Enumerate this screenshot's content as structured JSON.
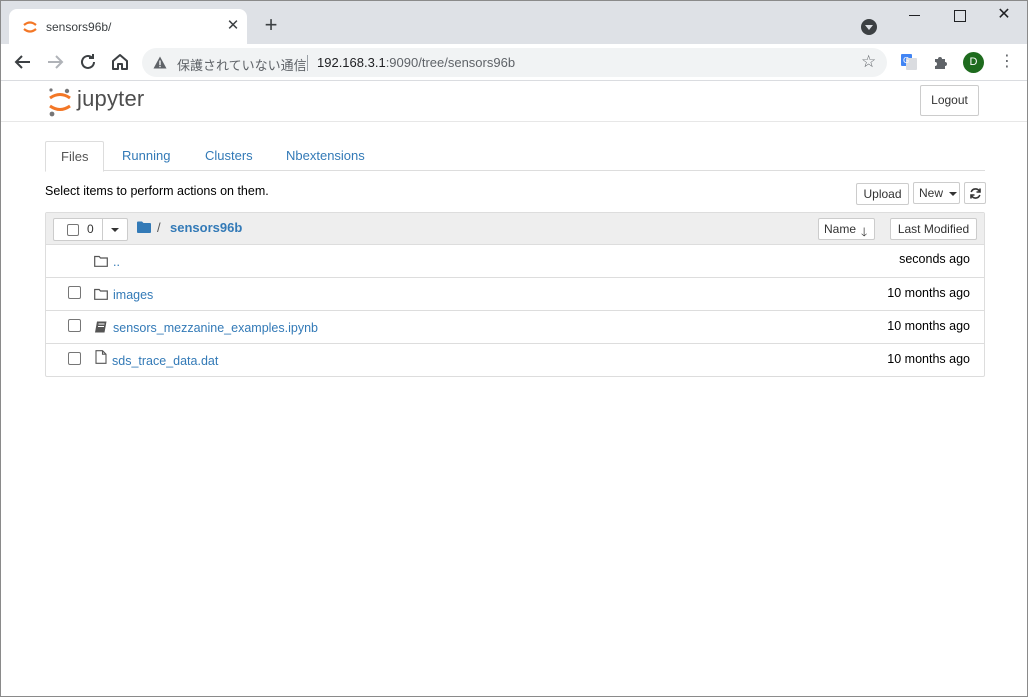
{
  "browser": {
    "tab_title": "sensors96b/",
    "security_text": "保護されていない通信",
    "url_host": "192.168.3.1",
    "url_rest": ":9090/tree/sensors96b",
    "profile_initial": "D"
  },
  "jupyter": {
    "logo_text": "jupyter",
    "logout_label": "Logout",
    "tabs": [
      {
        "label": "Files"
      },
      {
        "label": "Running"
      },
      {
        "label": "Clusters"
      },
      {
        "label": "Nbextensions"
      }
    ],
    "hint": "Select items to perform actions on them.",
    "upload_label": "Upload",
    "new_label": "New",
    "list": {
      "selected_count": "0",
      "crumb_separator": "/",
      "current_folder": "sensors96b",
      "sort_name_label": "Name",
      "sort_modified_label": "Last Modified",
      "rows": [
        {
          "name": "..",
          "time": "seconds ago",
          "kind": "folder"
        },
        {
          "name": "images",
          "time": "10 months ago",
          "kind": "folder"
        },
        {
          "name": "sensors_mezzanine_examples.ipynb",
          "time": "10 months ago",
          "kind": "notebook"
        },
        {
          "name": "sds_trace_data.dat",
          "time": "10 months ago",
          "kind": "file"
        }
      ]
    }
  },
  "colors": {
    "link": "#337ab7",
    "jupyter_orange": "#f37726"
  }
}
